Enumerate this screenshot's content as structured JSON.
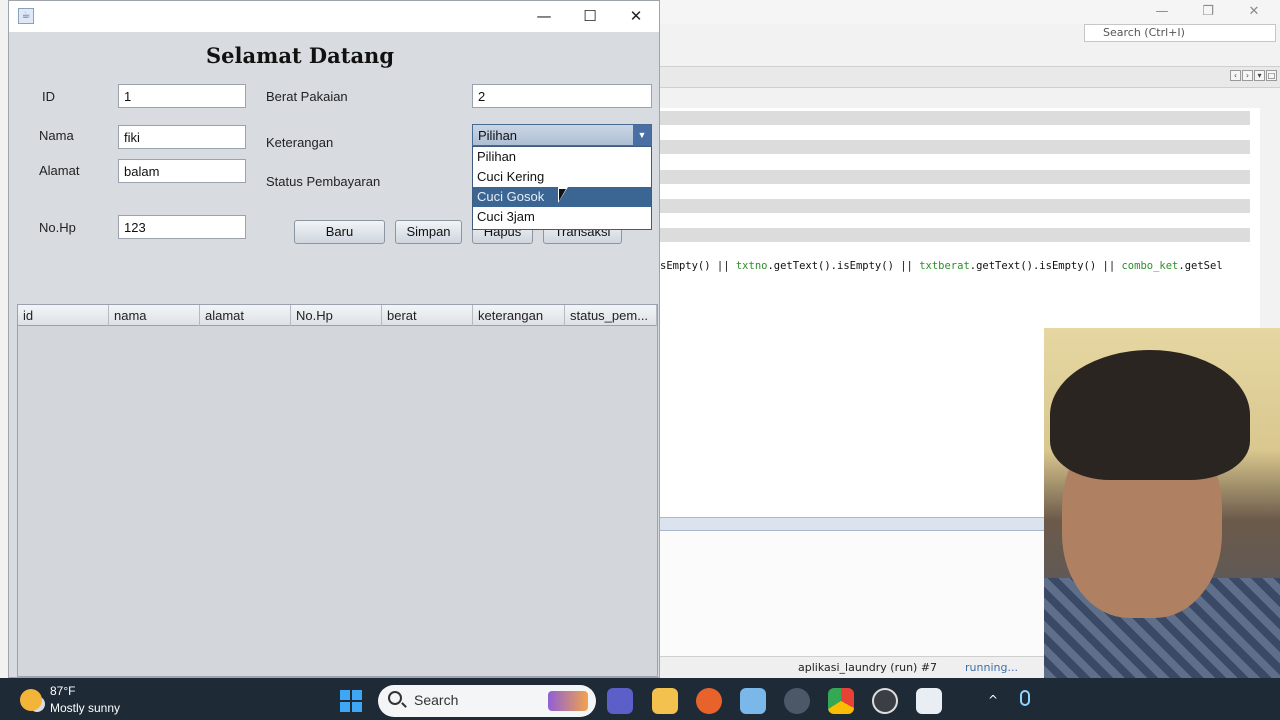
{
  "ide": {
    "search_placeholder": "Search (Ctrl+I)",
    "code_line_parts": [
      {
        "text": "sEmpty() || ",
        "kw": false
      },
      {
        "text": "txtno",
        "kw": true
      },
      {
        "text": ".getText().isEmpty() || ",
        "kw": false
      },
      {
        "text": "txtberat",
        "kw": true
      },
      {
        "text": ".getText().isEmpty() || ",
        "kw": false
      },
      {
        "text": "combo_ket",
        "kw": true
      },
      {
        "text": ".getSel",
        "kw": false
      }
    ],
    "run_label": "aplikasi_laundry (run) #7",
    "run_state": "running..."
  },
  "app": {
    "heading": "Selamat Datang",
    "labels": {
      "id": "ID",
      "nama": "Nama",
      "alamat": "Alamat",
      "nohp": "No.Hp",
      "berat": "Berat Pakaian",
      "keterangan": "Keterangan",
      "status": "Status Pembayaran"
    },
    "fields": {
      "id": "1",
      "nama": "fiki",
      "alamat": "balam",
      "nohp": "123",
      "berat": "2"
    },
    "combo": {
      "selected": "Pilihan",
      "options": [
        "Pilihan",
        "Cuci Kering",
        "Cuci Gosok",
        "Cuci 3jam"
      ],
      "highlighted_index": 2
    },
    "buttons": {
      "baru": "Baru",
      "simpan": "Simpan",
      "hapus": "Hapus",
      "transaksi": "Transaksi"
    },
    "table": {
      "columns": [
        "id",
        "nama",
        "alamat",
        "No.Hp",
        "berat",
        "keterangan",
        "status_pem..."
      ]
    }
  },
  "taskbar": {
    "temperature": "87°F",
    "weather": "Mostly sunny",
    "search_label": "Search"
  },
  "colors": {
    "selection": "#3b6694",
    "combo_arrow": "#4a6fa5",
    "code_keyword": "#2b8f2b",
    "run_state": "#3c6fa8"
  }
}
